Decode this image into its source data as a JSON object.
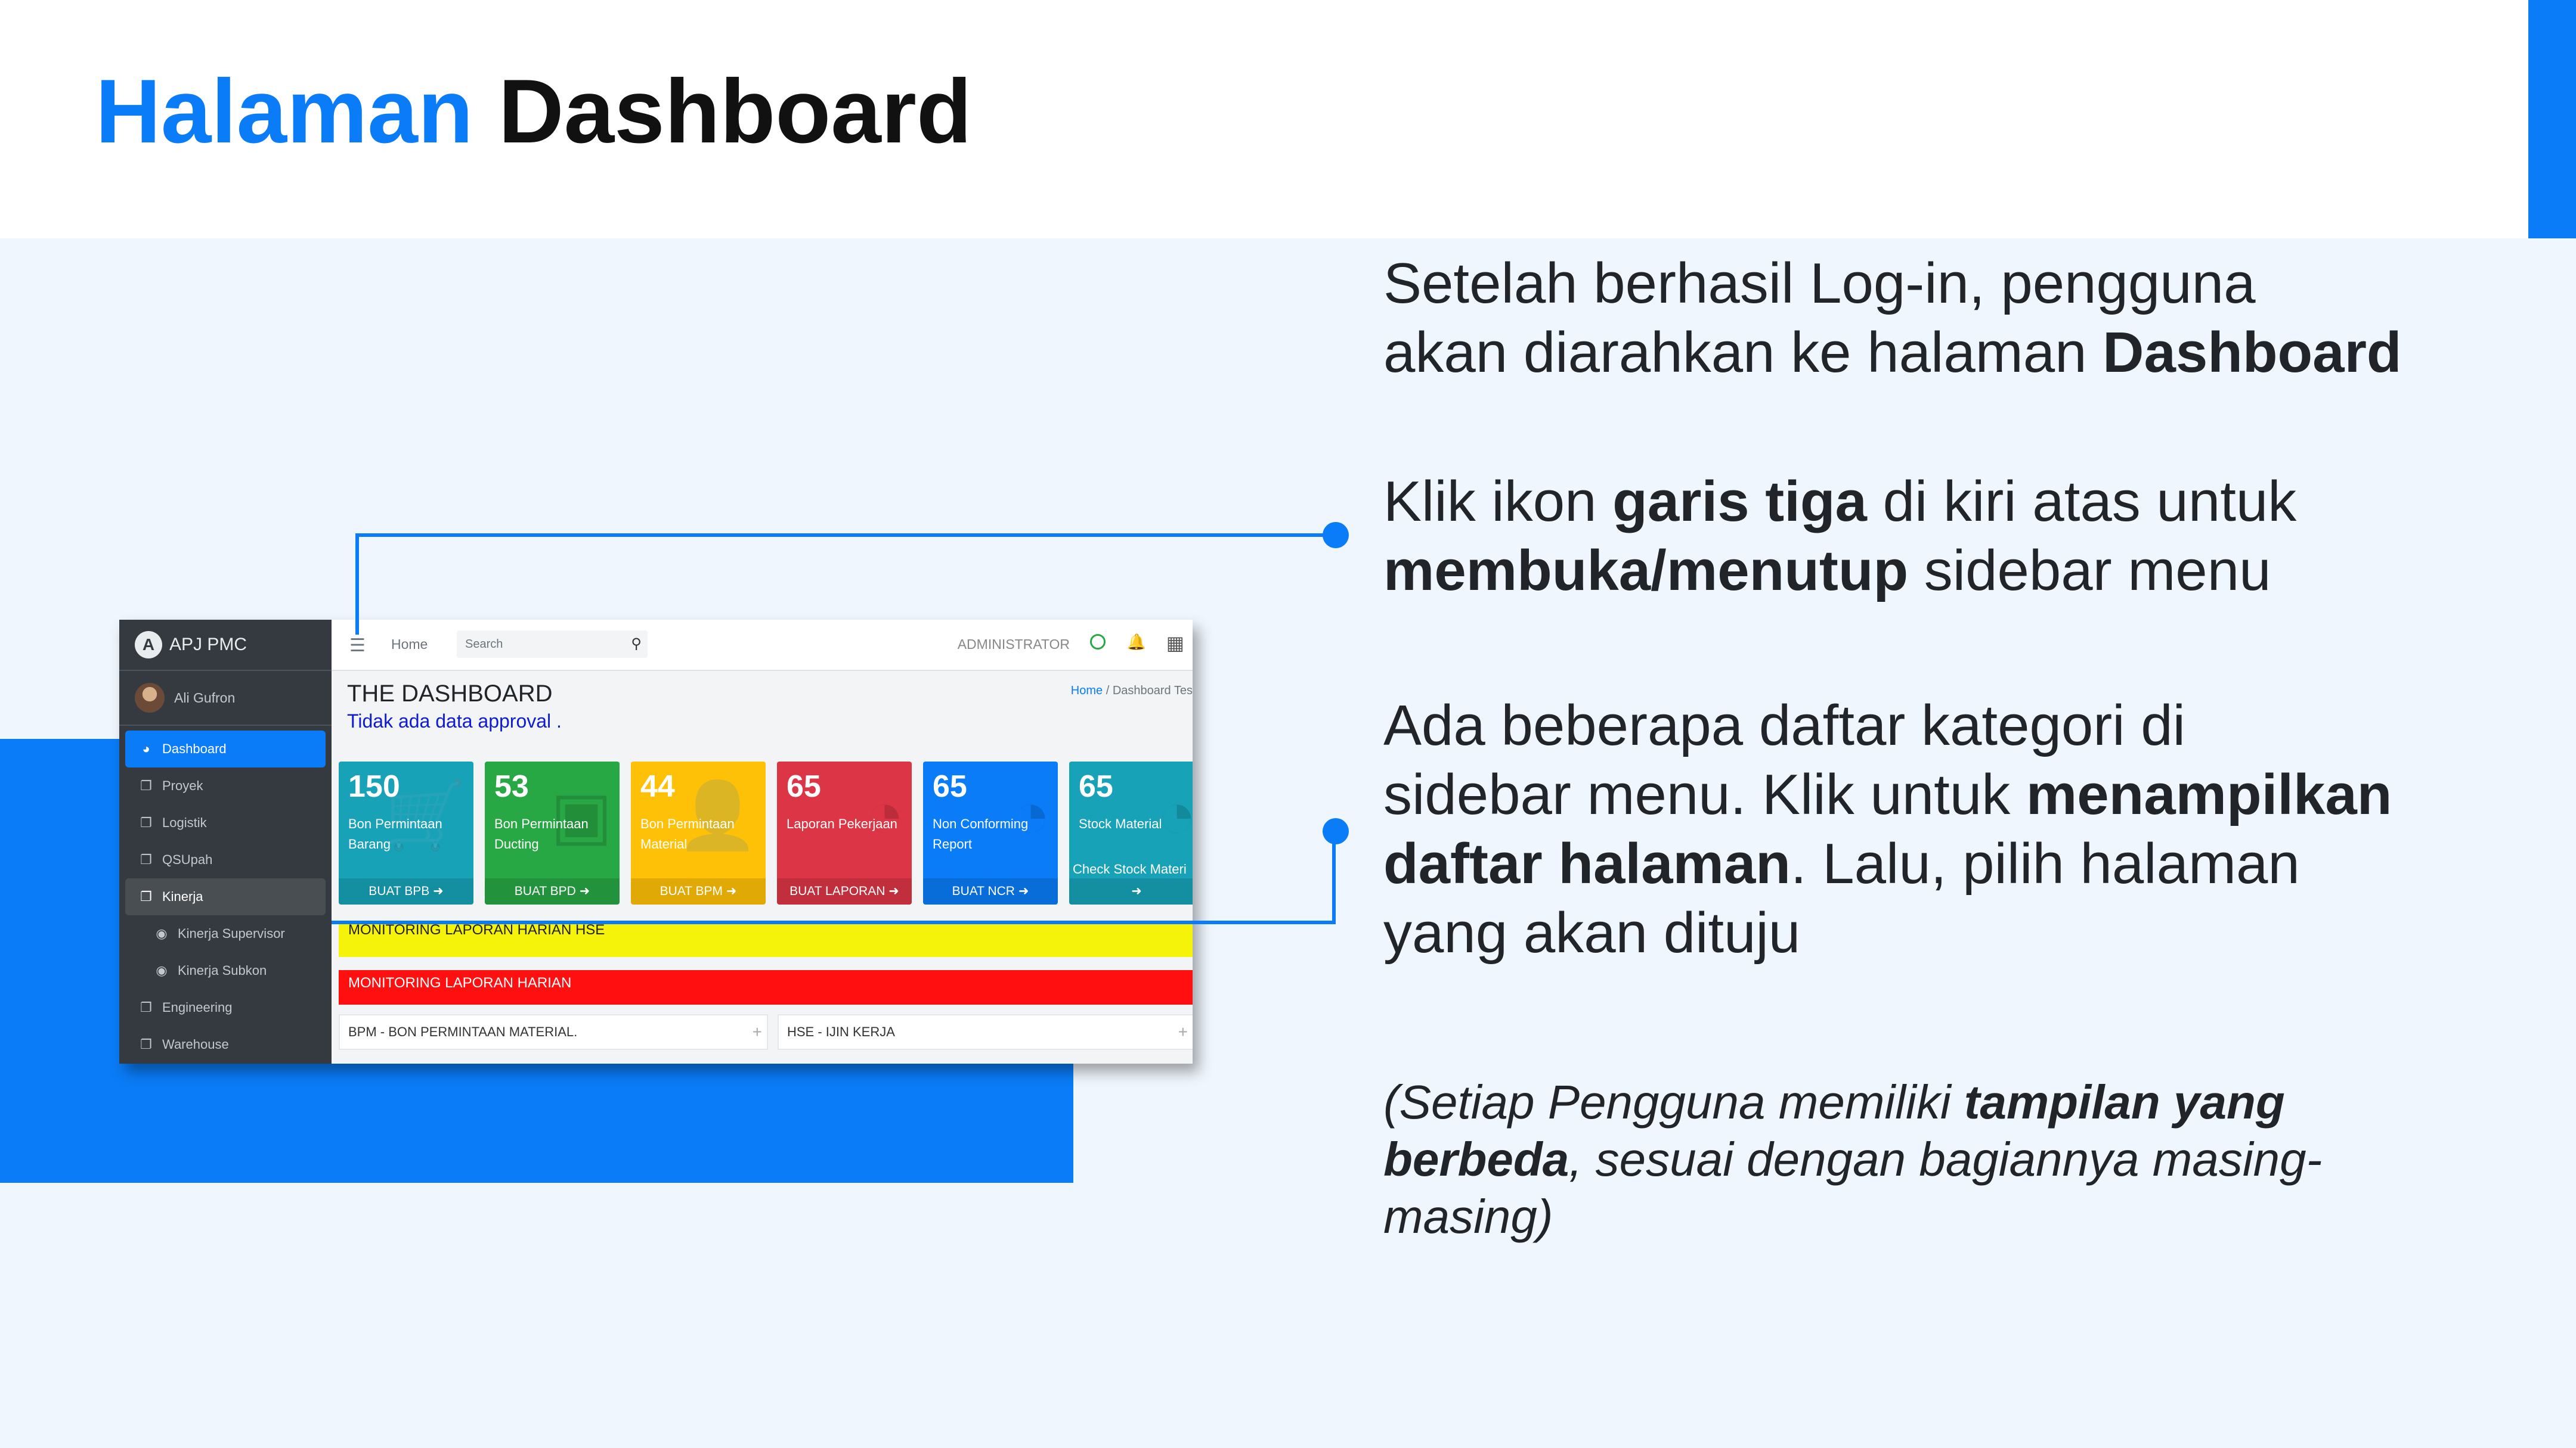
{
  "slide": {
    "title_highlight": "Halaman",
    "title_rest": "Dashboard",
    "colors": {
      "accent": "#0a7cf7",
      "background": "#f0f6fd"
    }
  },
  "app": {
    "brand": "APJ PMC",
    "user_name": "Ali Gufron",
    "sidebar": {
      "items": [
        {
          "label": "Dashboard",
          "icon": "dashboard-icon"
        },
        {
          "label": "Proyek",
          "icon": "copy-icon"
        },
        {
          "label": "Logistik",
          "icon": "copy-icon"
        },
        {
          "label": "QSUpah",
          "icon": "copy-icon"
        },
        {
          "label": "Kinerja",
          "icon": "copy-icon"
        },
        {
          "label": "Kinerja Supervisor",
          "icon": "circle-dot-icon"
        },
        {
          "label": "Kinerja Subkon",
          "icon": "circle-dot-icon"
        },
        {
          "label": "Engineering",
          "icon": "copy-icon"
        },
        {
          "label": "Warehouse",
          "icon": "copy-icon"
        }
      ]
    },
    "topbar": {
      "home": "Home",
      "search_placeholder": "Search",
      "role": "ADMINISTRATOR"
    },
    "content": {
      "title": "THE DASHBOARD",
      "approval_text": "Tidak ada data approval .",
      "breadcrumb_home": "Home",
      "breadcrumb_sep": "/",
      "breadcrumb_current": "Dashboard Tes"
    },
    "cards": [
      {
        "number": "150",
        "label": "Bon Permintaan Barang",
        "footer": "BUAT BPB",
        "color": "#17a2b8",
        "icon": "cart-icon"
      },
      {
        "number": "53",
        "label": "Bon Permintaan Ducting",
        "footer": "BUAT BPD",
        "color": "#28a745",
        "icon": "box-icon"
      },
      {
        "number": "44",
        "label": "Bon Permintaan Material",
        "footer": "BUAT BPM",
        "color": "#ffc107",
        "icon": "user-plus-icon"
      },
      {
        "number": "65",
        "label": "Laporan Pekerjaan",
        "footer": "BUAT LAPORAN",
        "color": "#dc3545",
        "icon": "pie-chart-icon"
      },
      {
        "number": "65",
        "label": "Non Conforming Report",
        "footer": "BUAT NCR",
        "color": "#0a7cf7",
        "icon": "pie-chart-icon"
      },
      {
        "number": "65",
        "label": "Stock Material",
        "extra": "Check Stock Materi",
        "footer": "",
        "color": "#17a2b8",
        "icon": "pie-chart-icon"
      }
    ],
    "monitoring": [
      {
        "label": "MONITORING LAPORAN HARIAN HSE",
        "color": "#f5f30a"
      },
      {
        "label": "MONITORING LAPORAN HARIAN",
        "color": "#ff0f0f"
      }
    ],
    "panels": [
      {
        "label": "BPM - BON PERMINTAAN MATERIAL."
      },
      {
        "label": "HSE - IJIN KERJA"
      }
    ]
  },
  "instructions": {
    "p1_a": "Setelah berhasil Log-in, pengguna",
    "p1_b": "akan diarahkan ke halaman ",
    "p1_bold": "Dashboard",
    "p2_a": "Klik ikon ",
    "p2_bold1": "garis tiga",
    "p2_b": " di kiri atas untuk",
    "p2_bold2": "membuka/menutup",
    "p2_c": " sidebar menu",
    "p3_a": "Ada beberapa daftar kategori di",
    "p3_b": "sidebar menu. Klik untuk ",
    "p3_bold1": "menampilkan",
    "p3_bold2": "daftar halaman",
    "p3_c": ". Lalu, pilih halaman",
    "p3_d": "yang akan dituju",
    "note_a": "(Setiap Pengguna memiliki ",
    "note_bold": "tampilan yang berbeda",
    "note_b": ", sesuai dengan bagiannya masing-masing)"
  }
}
